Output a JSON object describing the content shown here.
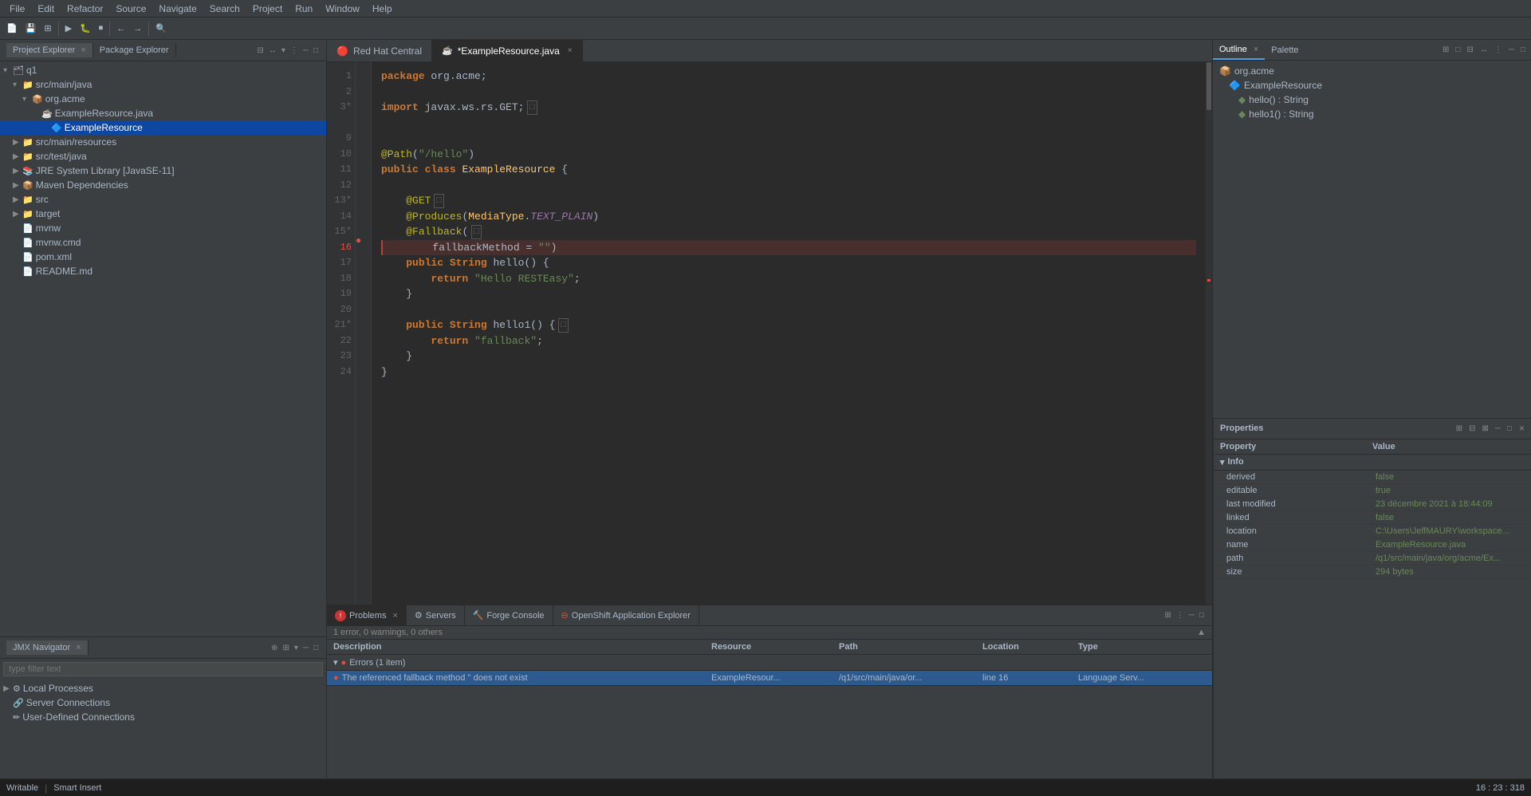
{
  "menubar": {
    "items": [
      "File",
      "Edit",
      "Refactor",
      "Source",
      "Navigate",
      "Search",
      "Project",
      "Run",
      "Window",
      "Help"
    ]
  },
  "left_panel": {
    "tabs": [
      {
        "label": "Project Explorer",
        "active": true
      },
      {
        "label": "Package Explorer",
        "active": false
      }
    ],
    "tree": [
      {
        "indent": 0,
        "arrow": "▾",
        "icon": "📁",
        "label": "q1",
        "type": "project"
      },
      {
        "indent": 1,
        "arrow": "▾",
        "icon": "📁",
        "label": "src/main/java",
        "type": "folder"
      },
      {
        "indent": 2,
        "arrow": "▾",
        "icon": "📁",
        "label": "org.acme",
        "type": "package"
      },
      {
        "indent": 3,
        "arrow": " ",
        "icon": "☕",
        "label": "ExampleResource.java",
        "type": "java"
      },
      {
        "indent": 4,
        "arrow": " ",
        "icon": "📄",
        "label": "ExampleResource",
        "type": "class",
        "selected": true
      },
      {
        "indent": 1,
        "arrow": "▶",
        "icon": "📁",
        "label": "src/main/resources",
        "type": "folder"
      },
      {
        "indent": 1,
        "arrow": "▶",
        "icon": "📁",
        "label": "src/test/java",
        "type": "folder"
      },
      {
        "indent": 1,
        "arrow": "▶",
        "icon": "📚",
        "label": "JRE System Library [JavaSE-11]",
        "type": "lib"
      },
      {
        "indent": 1,
        "arrow": "▶",
        "icon": "📦",
        "label": "Maven Dependencies",
        "type": "maven"
      },
      {
        "indent": 1,
        "arrow": "▶",
        "icon": "📁",
        "label": "src",
        "type": "folder"
      },
      {
        "indent": 1,
        "arrow": "▶",
        "icon": "📁",
        "label": "target",
        "type": "folder"
      },
      {
        "indent": 1,
        "arrow": " ",
        "icon": "📄",
        "label": "mvnw",
        "type": "file"
      },
      {
        "indent": 1,
        "arrow": " ",
        "icon": "📄",
        "label": "mvnw.cmd",
        "type": "file"
      },
      {
        "indent": 1,
        "arrow": " ",
        "icon": "📄",
        "label": "pom.xml",
        "type": "file"
      },
      {
        "indent": 1,
        "arrow": " ",
        "icon": "📄",
        "label": "README.md",
        "type": "file"
      }
    ]
  },
  "jmx_panel": {
    "title": "JMX Navigator",
    "filter_placeholder": "type filter text",
    "items": [
      {
        "indent": 0,
        "arrow": "▶",
        "icon": "⚙",
        "label": "Local Processes"
      },
      {
        "indent": 0,
        "arrow": " ",
        "icon": "🔗",
        "label": "Server Connections"
      },
      {
        "indent": 0,
        "arrow": " ",
        "icon": "✏",
        "label": "User-Defined Connections"
      }
    ]
  },
  "editor": {
    "tabs": [
      {
        "label": "Red Hat Central",
        "icon": "redhat",
        "active": false,
        "closable": false
      },
      {
        "label": "*ExampleResource.java",
        "icon": "java",
        "active": true,
        "closable": true
      }
    ],
    "lines": [
      {
        "num": 1,
        "content": "package org.acme;",
        "tokens": [
          {
            "type": "kw",
            "text": "package"
          },
          {
            "type": "pkg",
            "text": " org.acme;"
          }
        ]
      },
      {
        "num": 2,
        "content": ""
      },
      {
        "num": 3,
        "content": "import javax.ws.rs.GET;",
        "fold": true,
        "tokens": [
          {
            "type": "kw",
            "text": "import"
          },
          {
            "type": "pkg",
            "text": " javax.ws.rs.GET;"
          }
        ]
      },
      {
        "num": 9,
        "content": ""
      },
      {
        "num": 10,
        "content": "@Path(\"/hello\")",
        "tokens": [
          {
            "type": "ann",
            "text": "@Path"
          },
          {
            "type": "normal",
            "text": "("
          },
          {
            "type": "str",
            "text": "\"/hello\""
          },
          {
            "type": "normal",
            "text": ")"
          }
        ]
      },
      {
        "num": 11,
        "content": "public class ExampleResource {",
        "tokens": [
          {
            "type": "kw",
            "text": "public"
          },
          {
            "type": "normal",
            "text": " "
          },
          {
            "type": "kw",
            "text": "class"
          },
          {
            "type": "normal",
            "text": " "
          },
          {
            "type": "cls",
            "text": "ExampleResource"
          },
          {
            "type": "normal",
            "text": " {"
          }
        ]
      },
      {
        "num": 12,
        "content": ""
      },
      {
        "num": 13,
        "content": "    @GET",
        "fold": true,
        "tokens": [
          {
            "type": "ann",
            "text": "    @GET"
          }
        ]
      },
      {
        "num": 14,
        "content": "    @Produces(MediaType.TEXT_PLAIN)",
        "tokens": [
          {
            "type": "ann",
            "text": "    @Produces"
          },
          {
            "type": "normal",
            "text": "("
          },
          {
            "type": "cls",
            "text": "MediaType"
          },
          {
            "type": "normal",
            "text": "."
          },
          {
            "type": "ann2",
            "text": "TEXT_PLAIN"
          },
          {
            "type": "normal",
            "text": ")"
          }
        ]
      },
      {
        "num": 15,
        "content": "    @Fallback(",
        "fold": true,
        "tokens": [
          {
            "type": "ann",
            "text": "    @Fallback"
          },
          {
            "type": "normal",
            "text": "("
          }
        ]
      },
      {
        "num": 16,
        "content": "        fallbackMethod = \"\")",
        "error": true,
        "tokens": [
          {
            "type": "normal",
            "text": "        fallbackMethod = "
          },
          {
            "type": "str",
            "text": "\"\""
          }
        ]
      },
      {
        "num": 17,
        "content": "    public String hello() {",
        "tokens": [
          {
            "type": "normal",
            "text": "    "
          },
          {
            "type": "kw",
            "text": "public"
          },
          {
            "type": "normal",
            "text": " "
          },
          {
            "type": "kw",
            "text": "String"
          },
          {
            "type": "normal",
            "text": " hello() {"
          }
        ]
      },
      {
        "num": 18,
        "content": "        return \"Hello RESTEasy\";",
        "tokens": [
          {
            "type": "normal",
            "text": "        "
          },
          {
            "type": "kw",
            "text": "return"
          },
          {
            "type": "normal",
            "text": " "
          },
          {
            "type": "str",
            "text": "\"Hello RESTEasy\""
          },
          {
            "type": "normal",
            "text": ";"
          }
        ]
      },
      {
        "num": 19,
        "content": "    }",
        "tokens": [
          {
            "type": "normal",
            "text": "    }"
          }
        ]
      },
      {
        "num": 20,
        "content": ""
      },
      {
        "num": 21,
        "content": "    public String hello1() {",
        "fold": true,
        "tokens": [
          {
            "type": "normal",
            "text": "    "
          },
          {
            "type": "kw",
            "text": "public"
          },
          {
            "type": "normal",
            "text": " "
          },
          {
            "type": "kw",
            "text": "String"
          },
          {
            "type": "normal",
            "text": " hello1() {"
          }
        ]
      },
      {
        "num": 22,
        "content": "        return \"fallback\";",
        "tokens": [
          {
            "type": "normal",
            "text": "        "
          },
          {
            "type": "kw",
            "text": "return"
          },
          {
            "type": "normal",
            "text": " "
          },
          {
            "type": "str",
            "text": "\"fallback\""
          },
          {
            "type": "normal",
            "text": ";"
          }
        ]
      },
      {
        "num": 23,
        "content": "    }",
        "tokens": [
          {
            "type": "normal",
            "text": "    }"
          }
        ]
      },
      {
        "num": 24,
        "content": "}",
        "tokens": [
          {
            "type": "normal",
            "text": "}"
          }
        ]
      }
    ]
  },
  "outline_panel": {
    "title": "Outline",
    "tabs": [
      {
        "label": "Outline",
        "active": true
      },
      {
        "label": "Palette",
        "active": false
      }
    ],
    "items": [
      {
        "indent": 0,
        "icon": "pkg",
        "label": "org.acme"
      },
      {
        "indent": 1,
        "icon": "cls",
        "label": "ExampleResource"
      },
      {
        "indent": 2,
        "icon": "method_green",
        "label": "hello() : String"
      },
      {
        "indent": 2,
        "icon": "method_green",
        "label": "hello1() : String"
      }
    ]
  },
  "bottom_panel": {
    "tabs": [
      {
        "label": "Problems",
        "active": true,
        "closable": true,
        "badge": "error"
      },
      {
        "label": "Servers",
        "active": false
      },
      {
        "label": "Forge Console",
        "active": false
      },
      {
        "label": "OpenShift Application Explorer",
        "active": false,
        "icon": "error"
      }
    ],
    "status": "1 error, 0 warnings, 0 others",
    "columns": [
      "Description",
      "Resource",
      "Path",
      "Location",
      "Type"
    ],
    "errors_group": "Errors (1 item)",
    "errors": [
      {
        "description": "The referenced fallback method '' does not exist",
        "resource": "ExampleResour...",
        "path": "/q1/src/main/java/or...",
        "location": "line 16",
        "type": "Language Serv..."
      }
    ]
  },
  "properties_panel": {
    "title": "Properties",
    "columns": [
      "Property",
      "Value"
    ],
    "section": "Info",
    "rows": [
      {
        "key": "derived",
        "value": "false"
      },
      {
        "key": "editable",
        "value": "true"
      },
      {
        "key": "last modified",
        "value": "23 décembre 2021 à 18:44:09"
      },
      {
        "key": "linked",
        "value": "false"
      },
      {
        "key": "location",
        "value": "C:\\Users\\JeffMAURY\\workspace..."
      },
      {
        "key": "name",
        "value": "ExampleResource.java"
      },
      {
        "key": "path",
        "value": "/q1/src/main/java/org/acme/Ex..."
      },
      {
        "key": "size",
        "value": "294  bytes"
      }
    ]
  },
  "status_bar": {
    "writable": "Writable",
    "insert_mode": "Smart Insert",
    "position": "16 : 23 : 318"
  }
}
